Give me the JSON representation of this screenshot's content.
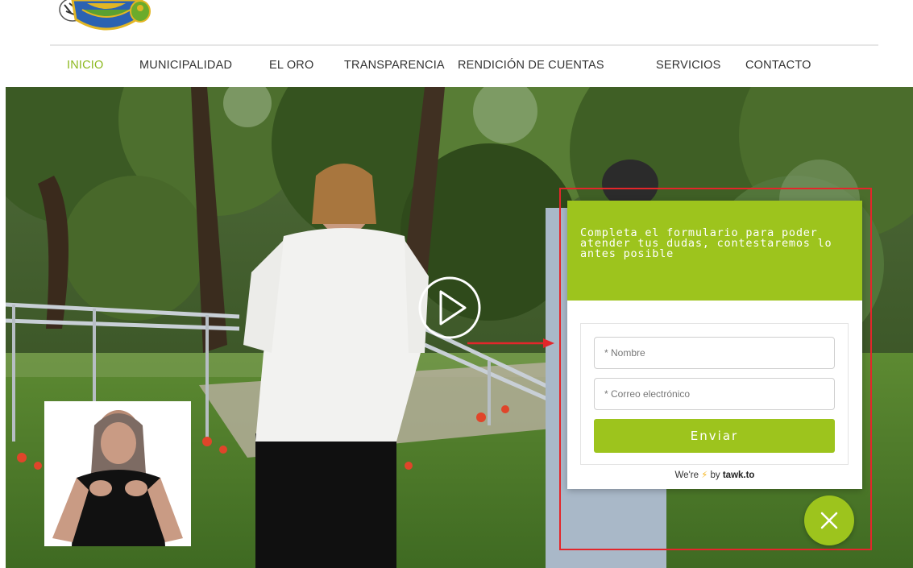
{
  "header": {
    "nav": [
      {
        "label": "INICIO",
        "active": true
      },
      {
        "label": "MUNICIPALIDAD",
        "active": false
      },
      {
        "label": "EL ORO",
        "active": false
      },
      {
        "label": "TRANSPARENCIA",
        "active": false
      },
      {
        "label": "RENDICIÓN DE CUENTAS",
        "active": false
      },
      {
        "label": "SERVICIOS",
        "active": false
      },
      {
        "label": "CONTACTO",
        "active": false
      }
    ]
  },
  "hero": {
    "play_icon": "play-circle-icon"
  },
  "chat_widget": {
    "heading": "Completa el formulario para poder atender tus dudas, contestaremos lo antes posible",
    "name_placeholder": "* Nombre",
    "email_placeholder": "* Correo electrónico",
    "send_label": "Enviar",
    "powered_prefix": "We're",
    "powered_suffix": "by",
    "powered_brand": "tawk.to",
    "close_icon": "close-icon"
  },
  "colors": {
    "accent": "#9dc41d",
    "nav_active": "#8cb81e",
    "annotation": "#e3262b"
  }
}
